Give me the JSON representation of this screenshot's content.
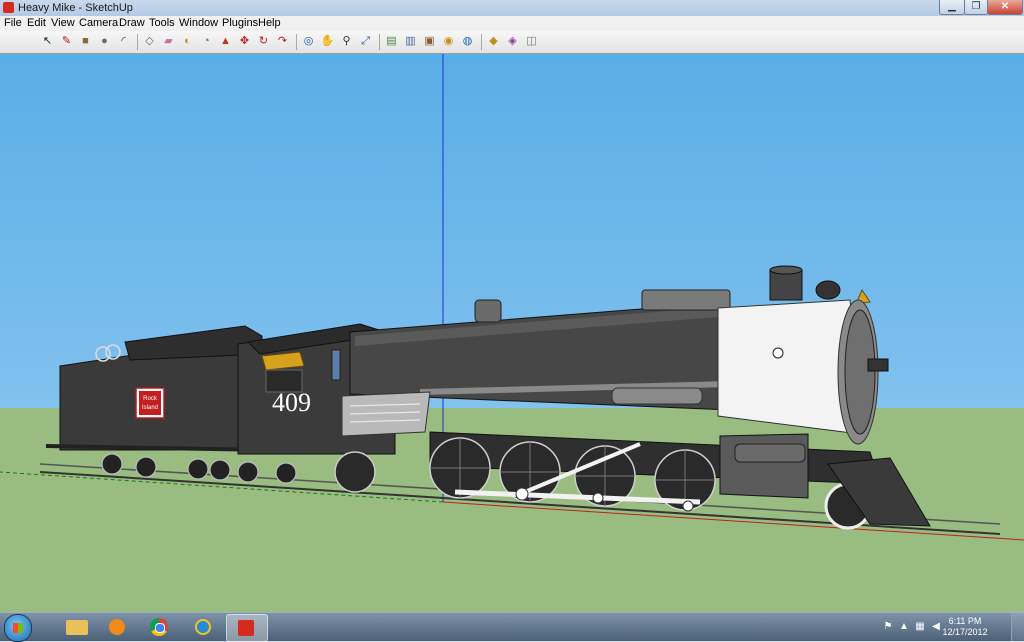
{
  "window": {
    "title": "Heavy Mike - SketchUp",
    "minimize": "▁",
    "restore": "❐",
    "close": "✕"
  },
  "menu": [
    "File",
    "Edit",
    "View",
    "Camera",
    "Draw",
    "Tools",
    "Window",
    "Plugins",
    "Help"
  ],
  "toolbar": [
    {
      "name": "select-tool",
      "glyph": "↖",
      "color": "#222222"
    },
    {
      "name": "line-tool",
      "glyph": "✎",
      "color": "#b01818"
    },
    {
      "name": "rectangle-tool",
      "glyph": "■",
      "color": "#8a6a3a"
    },
    {
      "name": "circle-tool",
      "glyph": "●",
      "color": "#6a6a6a"
    },
    {
      "name": "arc-tool",
      "glyph": "◜",
      "color": "#333333"
    },
    {
      "name": "make-component-tool",
      "glyph": "◇",
      "color": "#666666"
    },
    {
      "name": "eraser-tool",
      "glyph": "▰",
      "color": "#d46aa0"
    },
    {
      "name": "paint-bucket-tool",
      "glyph": "◐",
      "color": "#c88a1e"
    },
    {
      "name": "tape-measure-tool",
      "glyph": "◔",
      "color": "#6a6a6a"
    },
    {
      "name": "push-pull-tool",
      "glyph": "▲",
      "color": "#b83a1a"
    },
    {
      "name": "move-tool",
      "glyph": "✥",
      "color": "#c21a1a"
    },
    {
      "name": "rotate-tool",
      "glyph": "↻",
      "color": "#c21a1a"
    },
    {
      "name": "follow-me-tool",
      "glyph": "↷",
      "color": "#b01818"
    },
    {
      "name": "orbit-tool",
      "glyph": "◎",
      "color": "#1a5db0"
    },
    {
      "name": "pan-tool",
      "glyph": "✋",
      "color": "#555555"
    },
    {
      "name": "zoom-tool",
      "glyph": "⚲",
      "color": "#333333"
    },
    {
      "name": "zoom-extents-tool",
      "glyph": "⤢",
      "color": "#1a5db0"
    },
    {
      "name": "get-models-icon",
      "glyph": "▤",
      "color": "#4a8a3a"
    },
    {
      "name": "share-model-icon",
      "glyph": "▥",
      "color": "#4a6aa0"
    },
    {
      "name": "get-photo-texture-icon",
      "glyph": "▣",
      "color": "#8a5a2a"
    },
    {
      "name": "add-location-icon",
      "glyph": "◉",
      "color": "#d08a1a"
    },
    {
      "name": "google-earth-icon",
      "glyph": "◍",
      "color": "#1a6ab0"
    },
    {
      "name": "components-icon",
      "glyph": "◆",
      "color": "#c0901a"
    },
    {
      "name": "materials-icon",
      "glyph": "◈",
      "color": "#8a3a9a"
    },
    {
      "name": "styles-icon",
      "glyph": "◫",
      "color": "#7a7a7a"
    }
  ],
  "model": {
    "engine_number": "409",
    "herald_line1": "Rock",
    "herald_line2": "Island"
  },
  "taskbar": {
    "apps": [
      "explorer-icon",
      "media-player-icon",
      "chrome-icon",
      "internet-explorer-icon",
      "sketchup-icon"
    ],
    "clock_time": "6:11 PM",
    "clock_date": "12/17/2012"
  }
}
